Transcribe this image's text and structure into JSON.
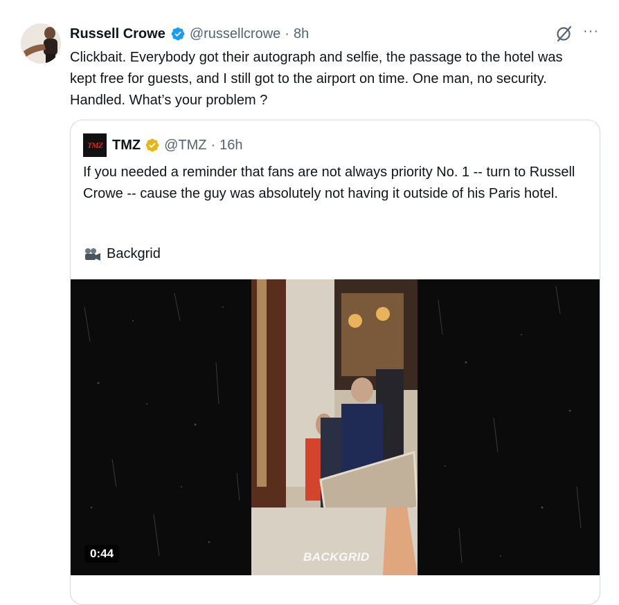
{
  "tweet": {
    "author_name": "Russell Crowe",
    "handle": "@russellcrowe",
    "separator": "·",
    "time": "8h",
    "text": "Clickbait. Everybody got their autograph and selfie, the passage to the hotel was kept free for guests, and I still got to the airport on time. One man, no security. Handled. What’s your problem ?",
    "more_label": "···",
    "verified_color": "#1d9bf0"
  },
  "quote": {
    "logo_text": "TMZ",
    "author_name": "TMZ",
    "handle": "@TMZ",
    "separator": "·",
    "time": "16h",
    "text": "If you needed a reminder that fans are not always priority No. 1 -- turn to Russell Crowe -- cause the guy was absolutely not having it outside of his Paris hotel.",
    "credit": "Backgrid",
    "credit_icon": "movie-camera-icon",
    "badge_color": "#e2b719"
  },
  "media": {
    "duration": "0:44",
    "watermark": "BACKGRID"
  },
  "colors": {
    "text_primary": "#0f1419",
    "text_secondary": "#536471",
    "border": "#cfd9de"
  }
}
